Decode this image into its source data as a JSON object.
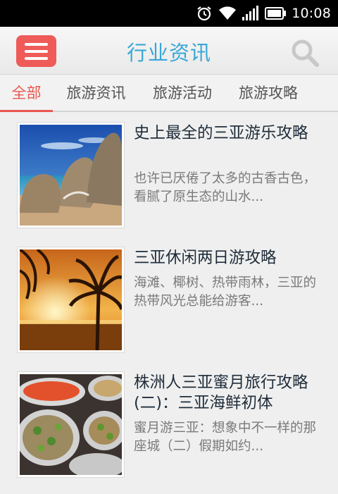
{
  "status_bar": {
    "time": "10:08",
    "icons": [
      "alarm-icon",
      "wifi-icon",
      "signal-icon",
      "battery-icon"
    ]
  },
  "header": {
    "title": "行业资讯",
    "menu_icon": "menu-icon",
    "search_icon": "search-icon",
    "accent_color": "#ee5b58",
    "title_color": "#3aa7d6"
  },
  "tabs": [
    {
      "label": "全部",
      "active": true
    },
    {
      "label": "旅游资讯",
      "active": false
    },
    {
      "label": "旅游活动",
      "active": false
    },
    {
      "label": "旅游攻略",
      "active": false
    }
  ],
  "articles": [
    {
      "title": "史上最全的三亚游乐攻略",
      "description": "也许已厌倦了太多的古香古色，看腻了原生态的山水...",
      "image": "beach-rocks-photo"
    },
    {
      "title": "三亚休闲两日游攻略",
      "description": "海滩、椰树、热带雨林，三亚的热带风光总能给游客...",
      "image": "sunset-palms-photo"
    },
    {
      "title": "株洲人三亚蜜月旅行攻略(二)：三亚海鲜初体",
      "description": "蜜月游三亚：想象中不一样的那座城（二）假期如约...",
      "image": "seafood-plates-photo"
    }
  ]
}
